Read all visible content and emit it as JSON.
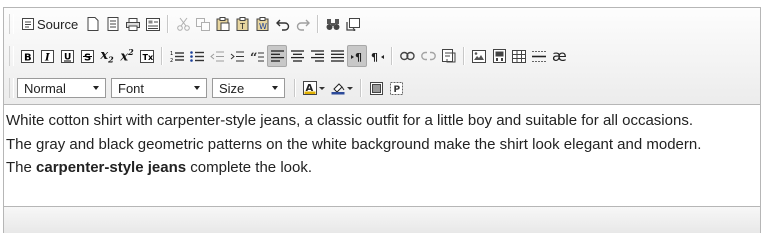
{
  "toolbar": {
    "source_label": "Source",
    "format_select": "Normal",
    "font_select": "Font",
    "size_select": "Size",
    "special_char": "æ",
    "subscript_label": "x",
    "subscript_mark": "2",
    "superscript_label": "x",
    "superscript_mark": "2",
    "colors": {
      "text_color": "#e0b000",
      "bg_color": "#2c4a99"
    }
  },
  "content": {
    "line1": "White cotton shirt with carpenter-style jeans, a classic outfit for a little boy and suitable for all occasions.",
    "line2": "The gray and black geometric patterns on the white background make the shirt look elegant and modern.",
    "line3_prefix": "The ",
    "line3_bold": "carpenter-style jeans",
    "line3_suffix": " complete the look."
  }
}
